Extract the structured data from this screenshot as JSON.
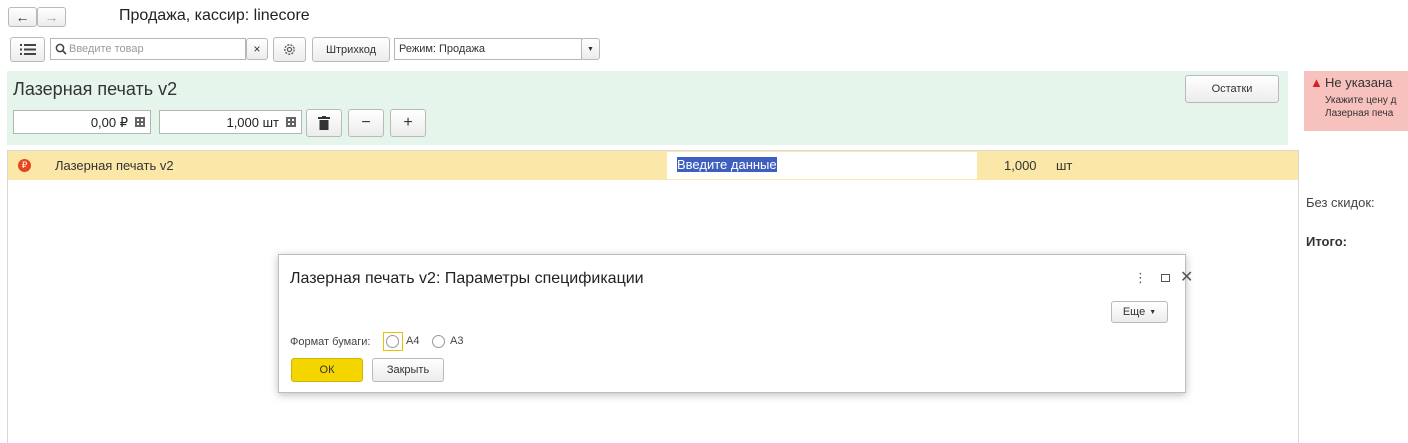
{
  "window": {
    "title": "Продажа, кассир: linecore",
    "back_icon": "arrow-left-icon",
    "forward_icon": "arrow-right-icon"
  },
  "toolbar": {
    "menu_icon": "list-icon",
    "search_placeholder": "Введите товар",
    "clear_label": "×",
    "settings_icon": "gear-icon",
    "barcode_label": "Штрихкод",
    "mode_value": "Режим: Продажа"
  },
  "product_panel": {
    "title": "Лазерная печать v2",
    "price_value": "0,00 ₽",
    "quantity_value": "1,000 шт",
    "delete_icon": "trash-icon",
    "minus_label": "−",
    "plus_label": "+",
    "stock_button_label": "Остатки"
  },
  "alert": {
    "title": "Не указана",
    "line1": "Укажите цену д",
    "line2": "Лазерная печа"
  },
  "cart": {
    "rows": [
      {
        "badge": "₽",
        "name": "Лазерная печать v2",
        "input_text": "Введите данные",
        "quantity": "1,000",
        "unit": "шт"
      }
    ]
  },
  "summary": {
    "discount_label": "Без скидок:",
    "total_label": "Итого:"
  },
  "dialog": {
    "title": "Лазерная печать v2: Параметры спецификации",
    "more_label": "Еще",
    "paper_format_label": "Формат бумаги:",
    "options": [
      "A4",
      "A3"
    ],
    "ok_label": "ОК",
    "close_label": "Закрыть"
  },
  "colors": {
    "panel_bg": "#e6f5ec",
    "row_bg": "#fbe7a8",
    "alert_bg": "#f7c1bd",
    "ok_bg": "#f5d500",
    "selection_bg": "#3f5fbf"
  }
}
